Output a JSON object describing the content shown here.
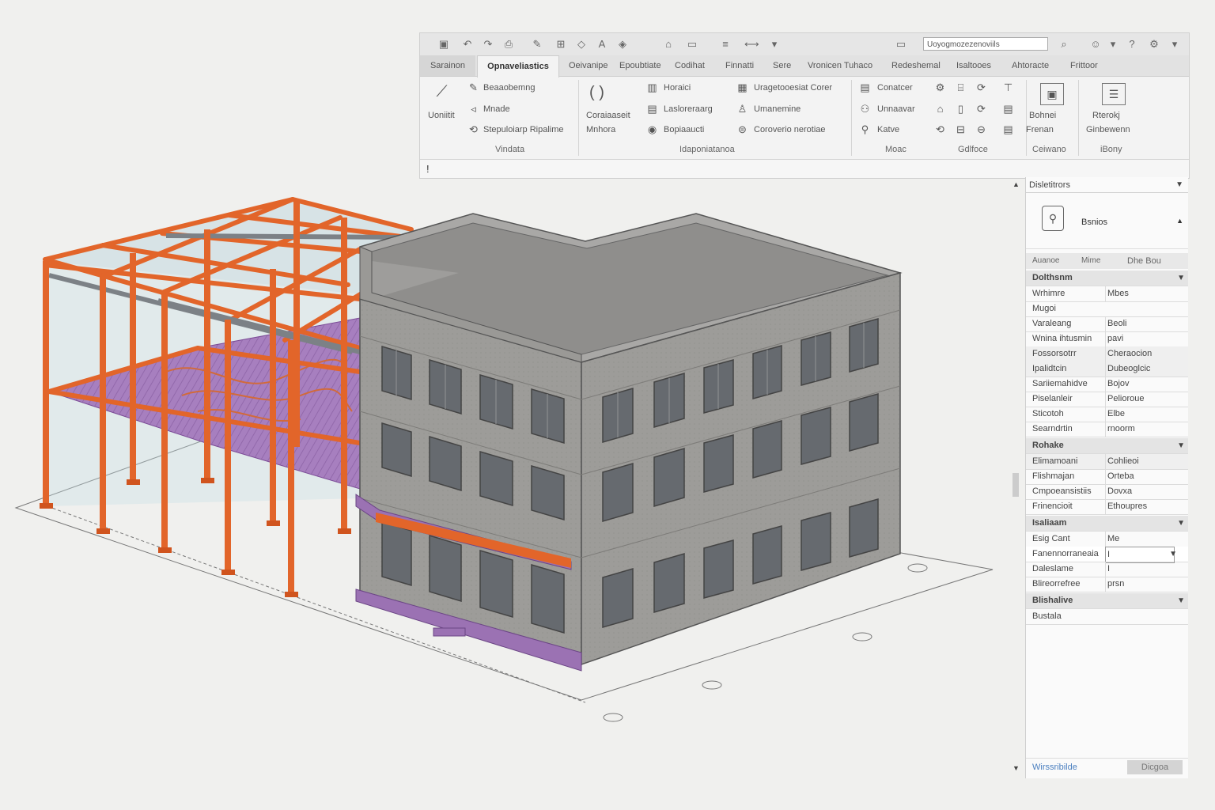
{
  "app": {
    "title_field": "Uoyogmozezenoviils",
    "quick_access_icons": [
      "save-icon",
      "undo-icon",
      "redo-icon",
      "print-icon",
      "measure-icon",
      "align-icon",
      "tag-icon",
      "text-icon",
      "section-icon",
      "3d-view-icon",
      "window-icon",
      "close-icon",
      "settings-icon"
    ]
  },
  "tabs": [
    "Sarainon",
    "Opnaveliastics",
    "Oeivanipe",
    "Epoubtiate",
    "Codihat",
    "Finnatti",
    "Sere",
    "Vronicen Tuhaco",
    "Redeshemal",
    "Isaltooes",
    "Ahtoracte",
    "Frittoor"
  ],
  "ribbon": {
    "modify_label": "Uoniitit",
    "group1": [
      "Beaaobemng",
      "Mnade",
      "Stepuloiarp Ripalime"
    ],
    "group2_brackets": "( )",
    "group2_labels": [
      "Coraiaaseit",
      "Mnhora"
    ],
    "group3": [
      "Horaici",
      "Lasloreraarg",
      "Bopiaaucti"
    ],
    "group4": [
      "Uragetooesiat Corer",
      "Umanemine",
      "Coroverio nerotiae"
    ],
    "group5": [
      "Conatcer",
      "Unnaavar",
      "Katve"
    ],
    "big_btn1": [
      "Bohnei",
      "Frenan"
    ],
    "big_btn2": [
      "Rterokj",
      "Ginbewenn"
    ],
    "group_labels": [
      "Vindata",
      "Idaponiatanoa",
      "Moac",
      "Gdlfoce",
      "Ceiwano",
      "iBony"
    ],
    "command_prompt": "!"
  },
  "properties": {
    "header": "Disletitrors",
    "type_name": "Bsnios",
    "tabs": [
      "Auanoe",
      "Mime",
      "Dhe Bou"
    ],
    "sections": [
      {
        "title": "Dolthsnm",
        "rows": [
          [
            "Wrhimre",
            "Mbes"
          ],
          [
            "Mugoi",
            ""
          ],
          [
            "Varaleang",
            "Beoli"
          ],
          [
            "Wnina ihtusmin",
            "pavi"
          ],
          [
            "Fossorsotrr",
            "Cheraocion"
          ],
          [
            "Ipalidtcin",
            "Dubeoglcic"
          ],
          [
            "Sariiemahidve",
            "Bojov"
          ],
          [
            "Piselanleir",
            "Pelioroue"
          ],
          [
            "Sticotoh",
            "Elbe"
          ],
          [
            "Searndrtin",
            "rnoorm"
          ]
        ]
      },
      {
        "title": "Rohake",
        "rows": [
          [
            "Elimamoani",
            "Cohlieoi"
          ],
          [
            "Flishmajan",
            "Orteba"
          ],
          [
            "Cmpoeansistiis",
            "Dovxa"
          ],
          [
            "Frinencioit",
            "Ethoupres"
          ]
        ]
      },
      {
        "title": "Isaliaam",
        "rows": [
          [
            "Esig Cant",
            "Me"
          ],
          [
            "Fanennorraneaia",
            "I"
          ],
          [
            "Daleslame",
            "I"
          ],
          [
            "Blireorrefree",
            "prsn"
          ]
        ]
      },
      {
        "title": "Blishalive",
        "rows": [
          [
            "Bustala",
            ""
          ]
        ]
      }
    ],
    "footer_link": "Wirssribilde",
    "footer_button": "Dicgoa"
  },
  "colors": {
    "steel": "#e2652a",
    "slab": "#9b72b3",
    "wall": "#9b9a97",
    "window": "#6f7378"
  }
}
